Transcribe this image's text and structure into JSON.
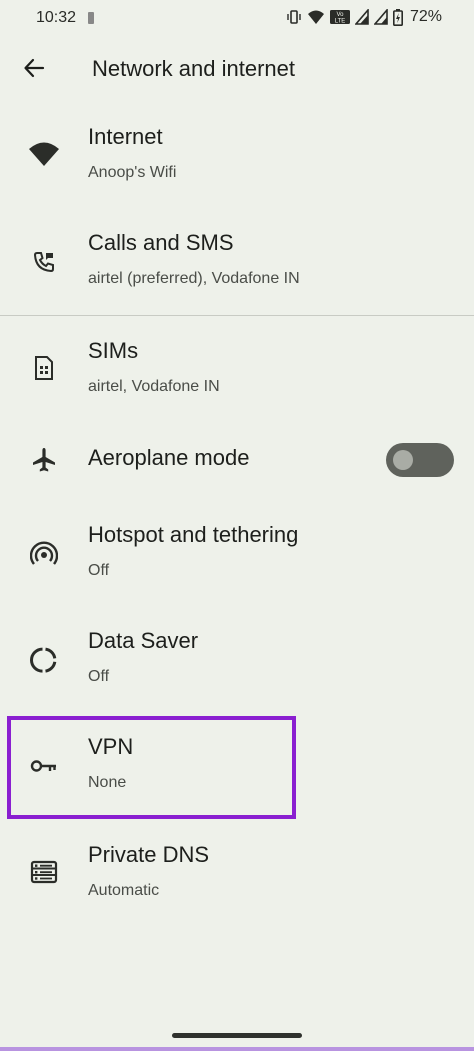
{
  "status": {
    "time": "10:32",
    "battery_percent": "72%",
    "icons": [
      "vibrate-icon",
      "wifi-icon",
      "volte-icon",
      "signal-icon",
      "signal-icon",
      "battery-charging-icon"
    ]
  },
  "appbar": {
    "title": "Network and internet",
    "back_icon": "arrow-back-icon"
  },
  "items": [
    {
      "title": "Internet",
      "subtitle": "Anoop's Wifi",
      "icon": "wifi-icon"
    },
    {
      "title": "Calls and SMS",
      "subtitle": "airtel (preferred), Vodafone IN",
      "icon": "call-sms-icon"
    },
    {
      "title": "SIMs",
      "subtitle": "airtel, Vodafone IN",
      "icon": "sim-card-icon"
    },
    {
      "title": "Aeroplane mode",
      "icon": "airplane-icon",
      "toggle": {
        "state": "off"
      }
    },
    {
      "title": "Hotspot and tethering",
      "subtitle": "Off",
      "icon": "hotspot-icon"
    },
    {
      "title": "Data Saver",
      "subtitle": "Off",
      "icon": "data-saver-icon"
    },
    {
      "title": "VPN",
      "subtitle": "None",
      "icon": "vpn-key-icon",
      "highlighted": true
    },
    {
      "title": "Private DNS",
      "subtitle": "Automatic",
      "icon": "dns-icon"
    }
  ],
  "colors": {
    "background": "#eef1ea",
    "highlight": "#8a1fd0",
    "text_primary": "#1d1f1c",
    "text_secondary": "#4a4d48"
  }
}
